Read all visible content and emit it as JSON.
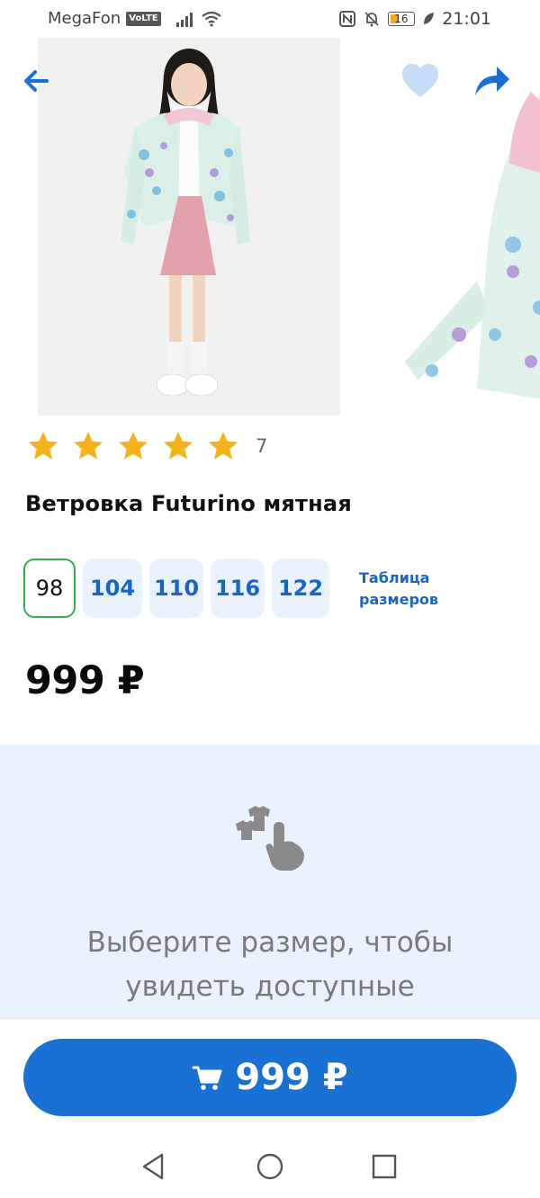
{
  "status_bar": {
    "carrier": "MegaFon",
    "volte": "VoLTE",
    "battery": "16",
    "time": "21:01"
  },
  "nav": {
    "back_icon": "arrow-left-icon",
    "favorite_icon": "heart-icon",
    "share_icon": "share-icon"
  },
  "product": {
    "rating_stars": 5,
    "rating_count": "7",
    "title": "Ветровка Futurino мятная",
    "sizes": [
      {
        "label": "98",
        "selected": true
      },
      {
        "label": "104",
        "selected": false
      },
      {
        "label": "110",
        "selected": false
      },
      {
        "label": "116",
        "selected": false
      },
      {
        "label": "122",
        "selected": false
      }
    ],
    "size_table_line1": "Таблица",
    "size_table_line2": "размеров",
    "price": "999 ₽"
  },
  "hint": {
    "icon": "select-size-hand-icon",
    "line1": "Выберите размер, чтобы",
    "line2": "увидеть доступные"
  },
  "buy_button": {
    "icon": "cart-icon",
    "label": "999 ₽"
  },
  "colors": {
    "accent_blue": "#1971d4",
    "link_blue": "#1766c4",
    "selected_border": "#2eb34a",
    "star": "#f5b21b",
    "panel_bg": "#e9f2fc"
  }
}
